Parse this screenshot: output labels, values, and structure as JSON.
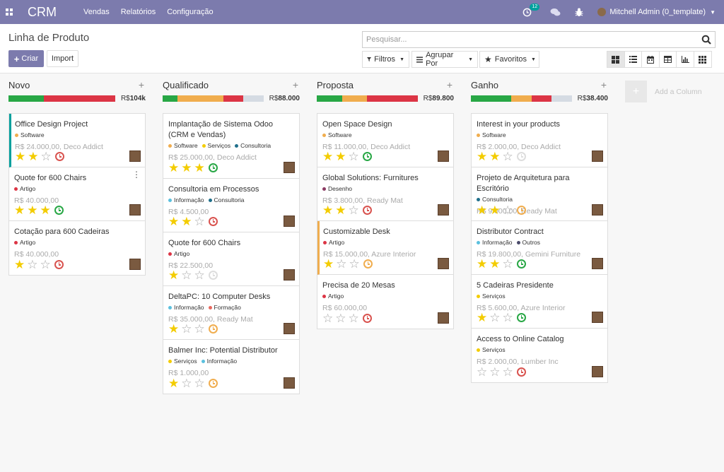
{
  "topbar": {
    "brand": "CRM",
    "menu": [
      "Vendas",
      "Relatórios",
      "Configuração"
    ],
    "activity_count": "12",
    "user": "Mitchell Admin (0_template)"
  },
  "control": {
    "title": "Linha de Produto",
    "create_label": "Criar",
    "import_label": "Import",
    "search_placeholder": "Pesquisar...",
    "filters_label": "Filtros",
    "groupby_label": "Agrupar Por",
    "favorites_label": "Favoritos"
  },
  "colors": {
    "brand": "#7c7bad",
    "green": "#28a745",
    "orange": "#f0ad4e",
    "red": "#dc3545",
    "grey": "#d5dbe3",
    "star": "#f3cc00"
  },
  "add_column_label": "Add a Column",
  "columns": [
    {
      "name": "Novo",
      "currency": "R$",
      "total": "104k",
      "progress": {
        "green": 0.33,
        "orange": 0,
        "red": 0.67,
        "grey": 0
      },
      "cards": [
        {
          "title": "Office Design Project",
          "tags": [
            {
              "label": "Software",
              "color": "#f0ad4e"
            }
          ],
          "amount": "R$ 24.000,00, Deco Addict",
          "stars": 2,
          "clock": "red",
          "accent": "teal",
          "tall": false,
          "kebab": false
        },
        {
          "title": "Quote for 600 Chairs",
          "tags": [
            {
              "label": "Artigo",
              "color": "#dc3545"
            }
          ],
          "amount": "R$ 40.000,00",
          "stars": 3,
          "clock": "green",
          "accent": "",
          "tall": false,
          "kebab": true
        },
        {
          "title": "Cotação para 600 Cadeiras",
          "tags": [
            {
              "label": "Artigo",
              "color": "#dc3545"
            }
          ],
          "amount": "R$ 40.000,00",
          "stars": 1,
          "clock": "red",
          "accent": "",
          "tall": false,
          "kebab": false
        }
      ]
    },
    {
      "name": "Qualificado",
      "currency": "R$",
      "total": "88.000",
      "progress": {
        "green": 0.15,
        "orange": 0.45,
        "red": 0.2,
        "grey": 0.2
      },
      "cards": [
        {
          "title": "Implantação de Sistema Odoo (CRM e Vendas)",
          "tags": [
            {
              "label": "Software",
              "color": "#f0ad4e"
            },
            {
              "label": "Serviços",
              "color": "#f3cc00"
            },
            {
              "label": "Consultoria",
              "color": "#1f6f8b"
            }
          ],
          "amount": "R$ 25.000,00, Deco Addict",
          "stars": 3,
          "clock": "green",
          "accent": "",
          "tall": true,
          "kebab": false
        },
        {
          "title": "Consultoria em Processos",
          "tags": [
            {
              "label": "Informação",
              "color": "#5bc0de"
            },
            {
              "label": "Consultoria",
              "color": "#1f6f8b"
            }
          ],
          "amount": "R$ 4.500,00",
          "stars": 2,
          "clock": "red",
          "accent": "",
          "tall": false,
          "kebab": false
        },
        {
          "title": "Quote for 600 Chairs",
          "tags": [
            {
              "label": "Artigo",
              "color": "#dc3545"
            }
          ],
          "amount": "R$ 22.500,00",
          "stars": 1,
          "clock": "grey",
          "accent": "",
          "tall": false,
          "kebab": false
        },
        {
          "title": "DeltaPC: 10 Computer Desks",
          "tags": [
            {
              "label": "Informação",
              "color": "#5bc0de"
            },
            {
              "label": "Formação",
              "color": "#e8685e"
            }
          ],
          "amount": "R$ 35.000,00, Ready Mat",
          "stars": 1,
          "clock": "orange",
          "accent": "",
          "tall": false,
          "kebab": false
        },
        {
          "title": "Balmer Inc: Potential Distributor",
          "tags": [
            {
              "label": "Serviços",
              "color": "#f3cc00"
            },
            {
              "label": "Informação",
              "color": "#5bc0de"
            }
          ],
          "amount": "R$ 1.000,00",
          "stars": 1,
          "clock": "orange",
          "accent": "",
          "tall": false,
          "kebab": false
        }
      ]
    },
    {
      "name": "Proposta",
      "currency": "R$",
      "total": "89.800",
      "progress": {
        "green": 0.25,
        "orange": 0.25,
        "red": 0.5,
        "grey": 0
      },
      "cards": [
        {
          "title": "Open Space Design",
          "tags": [
            {
              "label": "Software",
              "color": "#f0ad4e"
            }
          ],
          "amount": "R$ 11.000,00, Deco Addict",
          "stars": 2,
          "clock": "green",
          "accent": "",
          "tall": false,
          "kebab": false
        },
        {
          "title": "Global Solutions: Furnitures",
          "tags": [
            {
              "label": "Desenho",
              "color": "#8b3a62"
            }
          ],
          "amount": "R$ 3.800,00, Ready Mat",
          "stars": 2,
          "clock": "red",
          "accent": "",
          "tall": false,
          "kebab": false
        },
        {
          "title": "Customizable Desk",
          "tags": [
            {
              "label": "Artigo",
              "color": "#dc3545"
            }
          ],
          "amount": "R$ 15.000,00, Azure Interior",
          "stars": 1,
          "clock": "orange",
          "accent": "yellow",
          "tall": false,
          "kebab": false
        },
        {
          "title": "Precisa de 20 Mesas",
          "tags": [
            {
              "label": "Artigo",
              "color": "#dc3545"
            }
          ],
          "amount": "R$ 60.000,00",
          "stars": 0,
          "clock": "red",
          "accent": "",
          "tall": false,
          "kebab": false
        }
      ]
    },
    {
      "name": "Ganho",
      "currency": "R$",
      "total": "38.400",
      "progress": {
        "green": 0.4,
        "orange": 0.2,
        "red": 0.2,
        "grey": 0.2
      },
      "cards": [
        {
          "title": "Interest in your products",
          "tags": [
            {
              "label": "Software",
              "color": "#f0ad4e"
            }
          ],
          "amount": "R$ 2.000,00, Deco Addict",
          "stars": 2,
          "clock": "grey",
          "accent": "",
          "tall": false,
          "kebab": false
        },
        {
          "title": "Projeto de Arquitetura para Escritório",
          "tags": [
            {
              "label": "Consultoria",
              "color": "#1f6f8b"
            }
          ],
          "amount": "R$ 9.000,00, Ready Mat",
          "stars": 2,
          "clock": "orange",
          "accent": "",
          "tall": false,
          "kebab": false
        },
        {
          "title": "Distributor Contract",
          "tags": [
            {
              "label": "Informação",
              "color": "#5bc0de"
            },
            {
              "label": "Outros",
              "color": "#4a4a6a"
            }
          ],
          "amount": "R$ 19.800,00, Gemini Furniture",
          "stars": 2,
          "clock": "green",
          "accent": "",
          "tall": false,
          "kebab": false
        },
        {
          "title": "5 Cadeiras Presidente",
          "tags": [
            {
              "label": "Serviços",
              "color": "#f3cc00"
            }
          ],
          "amount": "R$ 5.600,00, Azure Interior",
          "stars": 1,
          "clock": "green",
          "accent": "",
          "tall": false,
          "kebab": false
        },
        {
          "title": "Access to Online Catalog",
          "tags": [
            {
              "label": "Serviços",
              "color": "#f3cc00"
            }
          ],
          "amount": "R$ 2.000,00, Lumber Inc",
          "stars": 0,
          "clock": "red",
          "accent": "",
          "tall": false,
          "kebab": false
        }
      ]
    }
  ]
}
